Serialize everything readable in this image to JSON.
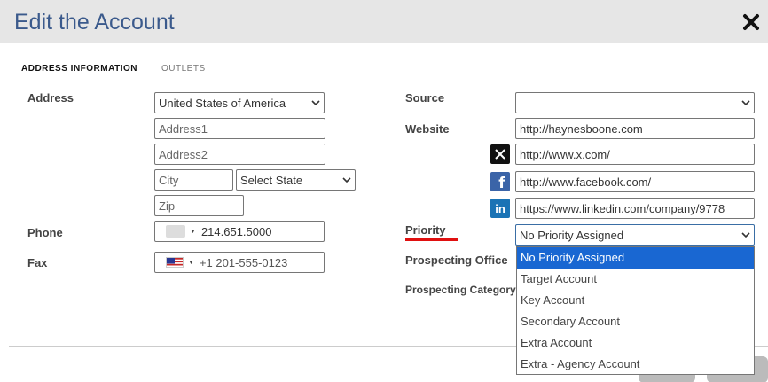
{
  "dialog": {
    "title": "Edit the Account",
    "close_icon": "close-x-icon"
  },
  "tabs": [
    {
      "label": "ADDRESS INFORMATION",
      "active": true
    },
    {
      "label": "OUTLETS",
      "active": false
    }
  ],
  "address": {
    "label": "Address",
    "country": "United States of America",
    "address1_placeholder": "Address1",
    "address2_placeholder": "Address2",
    "city_placeholder": "City",
    "state_selected": "Select State",
    "zip_placeholder": "Zip"
  },
  "phone": {
    "label": "Phone",
    "value": "214.651.5000"
  },
  "fax": {
    "label": "Fax",
    "value": "+1 201-555-0123"
  },
  "source": {
    "label": "Source",
    "value": ""
  },
  "website": {
    "label": "Website",
    "url": "http://haynesboone.com",
    "x_url": "http://www.x.com/",
    "facebook_url": "http://www.facebook.com/",
    "linkedin_url": "https://www.linkedin.com/company/9778"
  },
  "priority": {
    "label": "Priority",
    "selected": "No Priority Assigned",
    "options": [
      "No Priority Assigned",
      "Target Account",
      "Key Account",
      "Secondary Account",
      "Extra Account",
      "Extra - Agency Account"
    ]
  },
  "prospecting_office": {
    "label": "Prospecting Office"
  },
  "prospecting_category": {
    "label": "Prospecting Category"
  },
  "colors": {
    "title": "#3b5a8c",
    "highlight": "#1967d2",
    "underline": "#e01010",
    "header_bg": "#e6e6e6"
  }
}
